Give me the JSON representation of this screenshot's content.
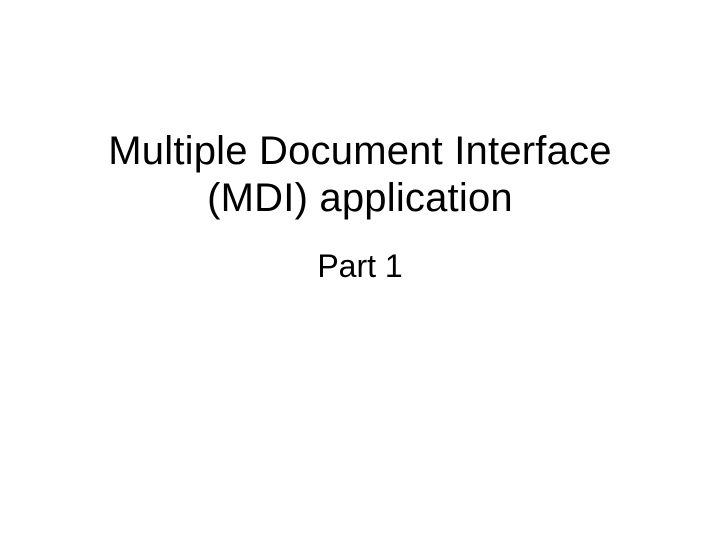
{
  "slide": {
    "title_line1": "Multiple Document Interface",
    "title_line2": "(MDI) application",
    "subtitle": "Part 1"
  }
}
